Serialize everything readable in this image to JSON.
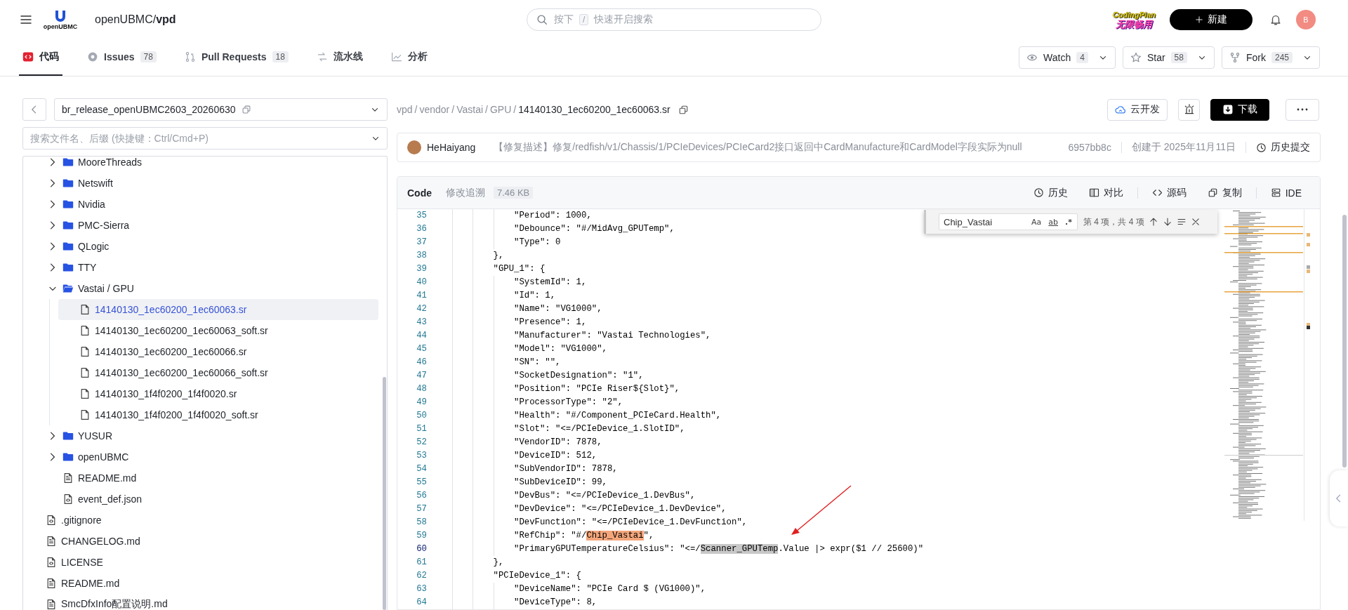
{
  "header": {
    "logo_text": "openUBMC",
    "repo": "openUBMC/**vpd**",
    "search": {
      "prefix": "按下",
      "key": "/",
      "placeholder": "快速开启搜索"
    },
    "promo": {
      "line1": "CodingPlan",
      "line2": "无限畅用"
    },
    "new_button": "新建",
    "avatar": "B"
  },
  "repo_tabs": [
    {
      "kind": "code",
      "label": "代码",
      "selected": true
    },
    {
      "kind": "issues",
      "label": "Issues",
      "count": "78",
      "selected": false
    },
    {
      "kind": "pr",
      "label": "Pull Requests",
      "count": "18",
      "selected": false
    },
    {
      "kind": "pipeline",
      "label": "流水线",
      "selected": false
    },
    {
      "kind": "chart",
      "label": "分析",
      "selected": false
    }
  ],
  "repo_actions": [
    {
      "kind": "watch",
      "label": "Watch",
      "count": "4"
    },
    {
      "kind": "star",
      "label": "Star",
      "count": "58"
    },
    {
      "kind": "fork",
      "label": "Fork",
      "count": "245"
    }
  ],
  "sidebar": {
    "branch": "br_release_openUBMC2603_20260630",
    "file_search": {
      "placeholder": "搜索文件名、后缀 (快捷键：Ctrl/Cmd+P)"
    },
    "tree": [
      {
        "children": [
          {
            "kind": "folder",
            "label": "MooreThreads",
            "expanded": false
          },
          {
            "kind": "folder",
            "label": "Netswift",
            "expanded": false
          },
          {
            "kind": "folder",
            "label": "Nvidia",
            "expanded": false
          },
          {
            "kind": "folder",
            "label": "PMC-Sierra",
            "expanded": false
          },
          {
            "kind": "folder",
            "label": "QLogic",
            "expanded": false
          },
          {
            "kind": "folder",
            "label": "TTY",
            "expanded": false
          },
          {
            "kind": "folder",
            "label": "Vastai / GPU",
            "expanded": true,
            "children": [
              {
                "kind": "file",
                "label": "14140130_1ec60200_1ec60063.sr",
                "selected": true
              },
              {
                "kind": "file",
                "label": "14140130_1ec60200_1ec60063_soft.sr",
                "selected": false
              },
              {
                "kind": "file",
                "label": "14140130_1ec60200_1ec60066.sr",
                "selected": false
              },
              {
                "kind": "file",
                "label": "14140130_1ec60200_1ec60066_soft.sr",
                "selected": false
              },
              {
                "kind": "file",
                "label": "14140130_1f4f0200_1f4f0020.sr",
                "selected": false
              },
              {
                "kind": "file",
                "label": "14140130_1f4f0200_1f4f0020_soft.sr",
                "selected": false
              }
            ]
          },
          {
            "kind": "folder",
            "label": "YUSUR",
            "expanded": false
          },
          {
            "kind": "folder",
            "label": "openUBMC",
            "expanded": false
          },
          {
            "kind": "doc",
            "label": "README.md",
            "selected": false
          },
          {
            "kind": "code",
            "label": "event_def.json",
            "selected": false
          }
        ]
      },
      {
        "kind": "code",
        "label": ".gitignore",
        "selected": false
      },
      {
        "kind": "doc",
        "label": "CHANGELOG.md",
        "selected": false
      },
      {
        "kind": "code",
        "label": "LICENSE",
        "selected": false
      },
      {
        "kind": "doc",
        "label": "README.md",
        "selected": false
      },
      {
        "kind": "doc",
        "label": "SmcDfxInfo配置说明.md",
        "selected": false
      }
    ]
  },
  "breadcrumb": {
    "separator": "/",
    "items": [
      "vpd",
      "vendor",
      "Vastai",
      "GPU",
      "14140130_1ec60200_1ec60063.sr"
    ]
  },
  "file_actions": [
    {
      "kind": "cloud",
      "label": "云开发"
    },
    {
      "kind": "alarm"
    },
    {
      "kind": "download",
      "label": "下载"
    },
    {
      "kind": "more"
    }
  ],
  "commit": {
    "author": "HeHaiyang",
    "message": "【修复描述】修复/redfish/v1/Chassis/1/PCIeDevices/PCIeCard2接口返回中CardManufacture和CardModel字段实际为null",
    "hash": "6957bb8c",
    "date": "创建于 2025年11月11日",
    "history": "历史提交"
  },
  "code_view": {
    "tabs": [
      {
        "label": "Code",
        "selected": true
      },
      {
        "label": "修改追溯",
        "selected": false
      }
    ],
    "size": "7.46 KB",
    "tools": [
      {
        "kind": "history",
        "label": "历史"
      },
      {
        "kind": "compare",
        "label": "对比"
      },
      {
        "kind": "source",
        "label": "源码"
      },
      {
        "kind": "copy",
        "label": "复制"
      },
      {
        "kind": "ide",
        "label": "IDE"
      }
    ],
    "find": {
      "value": "Chip_Vastai",
      "options": [
        {
          "kind": "case",
          "label": "Aa",
          "on": false
        },
        {
          "kind": "word",
          "label": "ab",
          "on": false
        },
        {
          "kind": "regex",
          "label": ".*",
          "on": false
        }
      ],
      "result": "第 4 项，共 4 项"
    },
    "lines": [
      {
        "number": "35",
        "current": false,
        "segments": [
          {
            "text": "                \"Period\": 1000,"
          }
        ]
      },
      {
        "number": "36",
        "current": false,
        "segments": [
          {
            "text": "                \"Debounce\": \"#/MidAvg_GPUTemp\","
          }
        ]
      },
      {
        "number": "37",
        "current": false,
        "segments": [
          {
            "text": "                \"Type\": 0"
          }
        ]
      },
      {
        "number": "38",
        "current": false,
        "segments": [
          {
            "text": "            },"
          }
        ]
      },
      {
        "number": "39",
        "current": false,
        "segments": [
          {
            "text": "            \"GPU_1\": {"
          }
        ]
      },
      {
        "number": "40",
        "current": false,
        "segments": [
          {
            "text": "                \"SystemId\": 1,"
          }
        ]
      },
      {
        "number": "41",
        "current": false,
        "segments": [
          {
            "text": "                \"Id\": 1,"
          }
        ]
      },
      {
        "number": "42",
        "current": false,
        "segments": [
          {
            "text": "                \"Name\": \"VG1000\","
          }
        ]
      },
      {
        "number": "43",
        "current": false,
        "segments": [
          {
            "text": "                \"Presence\": 1,"
          }
        ]
      },
      {
        "number": "44",
        "current": false,
        "segments": [
          {
            "text": "                \"Manufacturer\": \"Vastai Technologies\","
          }
        ]
      },
      {
        "number": "45",
        "current": false,
        "segments": [
          {
            "text": "                \"Model\": \"VG1000\","
          }
        ]
      },
      {
        "number": "46",
        "current": false,
        "segments": [
          {
            "text": "                \"SN\": \"\","
          }
        ]
      },
      {
        "number": "47",
        "current": false,
        "segments": [
          {
            "text": "                \"SocketDesignation\": \"1\","
          }
        ]
      },
      {
        "number": "48",
        "current": false,
        "segments": [
          {
            "text": "                \"Position\": \"PCIe Riser${Slot}\","
          }
        ]
      },
      {
        "number": "49",
        "current": false,
        "segments": [
          {
            "text": "                \"ProcessorType\": \"2\","
          }
        ]
      },
      {
        "number": "50",
        "current": false,
        "segments": [
          {
            "text": "                \"Health\": \"#/Component_PCIeCard.Health\","
          }
        ]
      },
      {
        "number": "51",
        "current": false,
        "segments": [
          {
            "text": "                \"Slot\": \"<=/PCIeDevice_1.SlotID\","
          }
        ]
      },
      {
        "number": "52",
        "current": false,
        "segments": [
          {
            "text": "                \"VendorID\": 7878,"
          }
        ]
      },
      {
        "number": "53",
        "current": false,
        "segments": [
          {
            "text": "                \"DeviceID\": 512,"
          }
        ]
      },
      {
        "number": "54",
        "current": false,
        "segments": [
          {
            "text": "                \"SubVendorID\": 7878,"
          }
        ]
      },
      {
        "number": "55",
        "current": false,
        "segments": [
          {
            "text": "                \"SubDeviceID\": 99,"
          }
        ]
      },
      {
        "number": "56",
        "current": false,
        "segments": [
          {
            "text": "                \"DevBus\": \"<=/PCIeDevice_1.DevBus\","
          }
        ]
      },
      {
        "number": "57",
        "current": false,
        "segments": [
          {
            "text": "                \"DevDevice\": \"<=/PCIeDevice_1.DevDevice\","
          }
        ]
      },
      {
        "number": "58",
        "current": false,
        "segments": [
          {
            "text": "                \"DevFunction\": \"<=/PCIeDevice_1.DevFunction\","
          }
        ]
      },
      {
        "number": "59",
        "current": false,
        "segments": [
          {
            "text": "                \"RefChip\": \"#/"
          },
          {
            "text": "Chip_Vastai",
            "kind": "match"
          },
          {
            "text": "\","
          }
        ]
      },
      {
        "number": "60",
        "current": true,
        "segments": [
          {
            "text": "                \"PrimaryGPUTemperatureCelsius\": \"<=/"
          },
          {
            "text": "Scanner_GPUTemp",
            "kind": "selection"
          },
          {
            "text": ".Value |> expr($1 // 25600)\""
          }
        ]
      },
      {
        "number": "61",
        "current": false,
        "segments": [
          {
            "text": "            },"
          }
        ]
      },
      {
        "number": "62",
        "current": false,
        "segments": [
          {
            "text": "            \"PCIeDevice_1\": {"
          }
        ]
      },
      {
        "number": "63",
        "current": false,
        "segments": [
          {
            "text": "                \"DeviceName\": \"PCIe Card $ (VG1000)\","
          }
        ]
      },
      {
        "number": "64",
        "current": false,
        "segments": [
          {
            "text": "                \"DeviceType\": 8,"
          }
        ]
      }
    ]
  }
}
